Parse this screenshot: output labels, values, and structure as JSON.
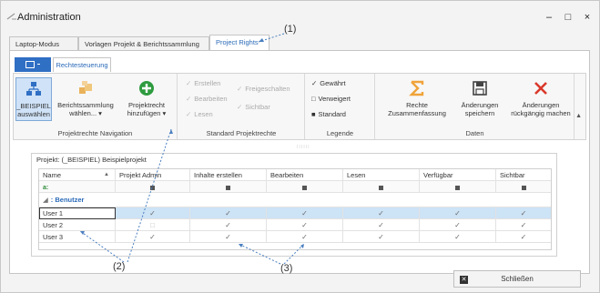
{
  "window": {
    "title": "Administration",
    "controls": [
      "–",
      "□",
      "×"
    ]
  },
  "tabs": [
    {
      "label": "Laptop-Modus",
      "active": false
    },
    {
      "label": "Vorlagen Projekt & Berichtssammlung",
      "active": false
    },
    {
      "label": "Project Rights",
      "active": true
    }
  ],
  "ribbon_tabs": {
    "menu_icon": "grid-menu-icon",
    "active_tab": "Rechtesteuerung"
  },
  "ribbon": {
    "groups": {
      "navigation": {
        "label": "Projektrechte Navigation",
        "buttons": [
          {
            "line1": "_BEISPIEL",
            "line2": "auswählen",
            "icon": "hierarchy-icon"
          },
          {
            "line1": "Berichtssammlung",
            "line2": "wählen... ▾",
            "icon": "boxes-icon"
          },
          {
            "line1": "Projektrecht",
            "line2": "hinzufügen ▾",
            "icon": "add-circle-icon"
          }
        ]
      },
      "standard": {
        "label": "Standard Projektrechte",
        "items": [
          "Erstellen",
          "Bearbeiten",
          "Lesen",
          "Freigeschalten",
          "Sichtbar"
        ]
      },
      "legend": {
        "label": "Legende",
        "items": [
          {
            "symbol": "✓",
            "text": "Gewährt"
          },
          {
            "symbol": "□",
            "text": "Verweigert"
          },
          {
            "symbol": "■",
            "text": "Standard"
          }
        ]
      },
      "data": {
        "label": "Daten",
        "buttons": [
          {
            "line1": "Rechte",
            "line2": "Zusammenfassung",
            "icon": "sigma-icon"
          },
          {
            "line1": "Änderungen",
            "line2": "speichern",
            "icon": "save-icon"
          },
          {
            "line1": "Änderungen",
            "line2": "rückgängig machen",
            "icon": "undo-x-icon"
          }
        ]
      }
    }
  },
  "panel": {
    "title": "Projekt: (_BEISPIEL) Beispielprojekt"
  },
  "grid": {
    "columns": [
      "Name",
      "Projekt Admin",
      "Inhalte erstellen",
      "Bearbeiten",
      "Lesen",
      "Verfügbar",
      "Sichtbar"
    ],
    "filter_symbol": "a:",
    "group_label": ": Benutzer",
    "rows": [
      {
        "name": "User 1",
        "values": [
          "✓",
          "✓",
          "✓",
          "✓",
          "✓",
          "✓"
        ],
        "selected": true
      },
      {
        "name": "User 2",
        "values": [
          "□",
          "✓",
          "✓",
          "✓",
          "✓",
          "✓"
        ],
        "selected": false
      },
      {
        "name": "User 3",
        "values": [
          "✓",
          "✓",
          "✓",
          "✓",
          "✓",
          "✓"
        ],
        "selected": false
      }
    ]
  },
  "footer": {
    "close_label": "Schließen"
  },
  "annotations": [
    "(1)",
    "(2)",
    "(3)"
  ]
}
